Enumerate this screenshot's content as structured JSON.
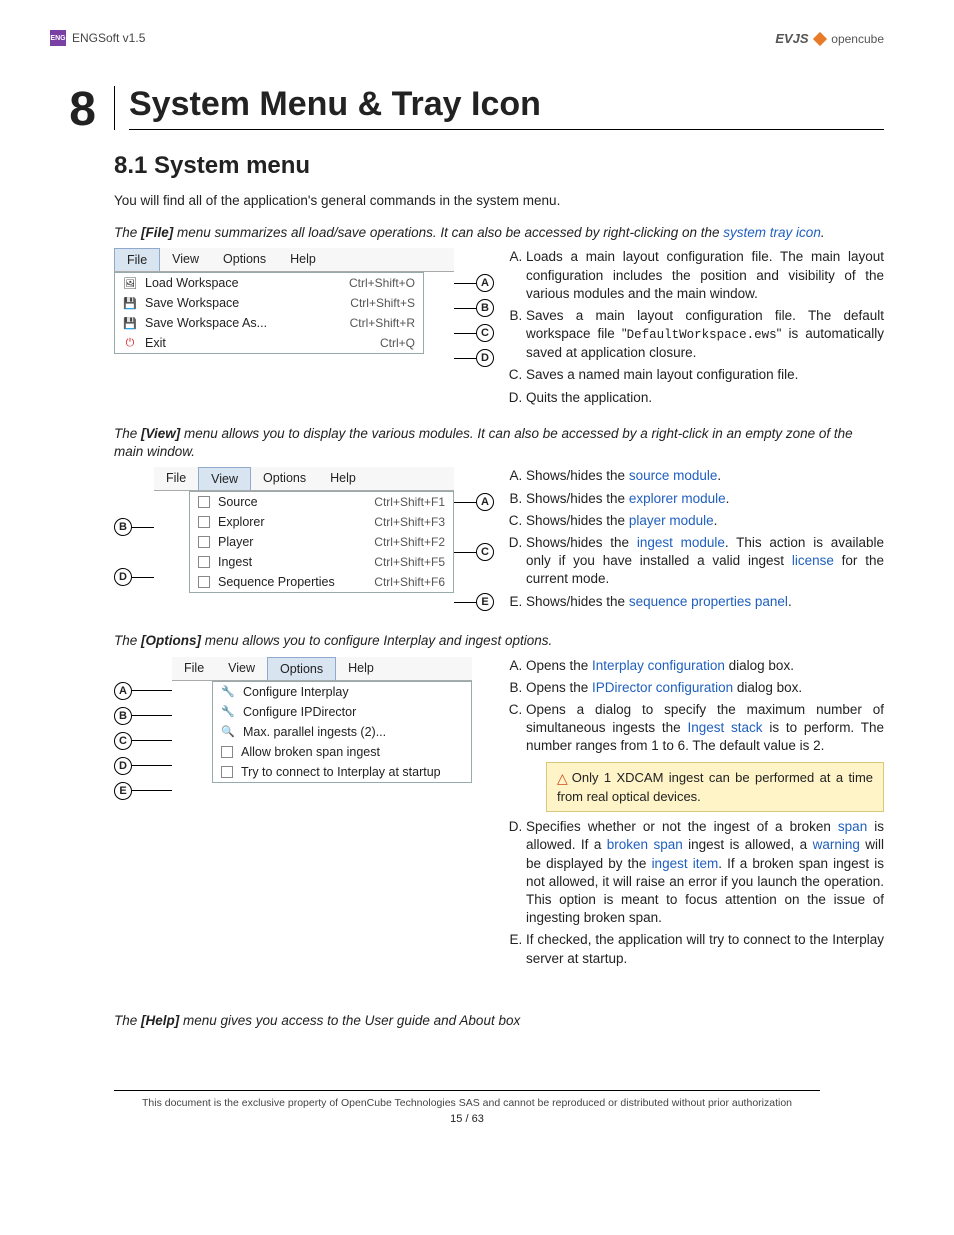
{
  "header": {
    "app": "ENGSoft v1.5",
    "brand_left": "EVJS",
    "brand_right": "opencube"
  },
  "chapter": {
    "num": "8",
    "title": "System Menu & Tray Icon"
  },
  "section": {
    "num_title": "8.1 System menu"
  },
  "intro": "You will find all of the application's general commands in the system menu.",
  "file": {
    "note_pre": "The ",
    "note_bold": "[File]",
    "note_post": " menu summarizes all load/save operations. It can also be accessed by right-clicking on the ",
    "note_link": "system tray icon",
    "note_end": ".",
    "menubar": [
      "File",
      "View",
      "Options",
      "Help"
    ],
    "items": [
      {
        "label": "Load Workspace",
        "shortcut": "Ctrl+Shift+O",
        "badge": "A"
      },
      {
        "label": "Save Workspace",
        "shortcut": "Ctrl+Shift+S",
        "badge": "B"
      },
      {
        "label": "Save Workspace As...",
        "shortcut": "Ctrl+Shift+R",
        "badge": "C"
      },
      {
        "label": "Exit",
        "shortcut": "Ctrl+Q",
        "badge": "D"
      }
    ],
    "desc": {
      "A": {
        "pre": "Loads a main layout configuration file. The main layout configuration includes the position and visibility of the various modules and the main window."
      },
      "B": {
        "pre": "Saves a main layout configuration file. The default workspace file \"",
        "code": "DefaultWorkspace.ews",
        "post": "\" is automatically saved at application closure."
      },
      "C": {
        "pre": "Saves a named main layout configuration file."
      },
      "D": {
        "pre": "Quits the application."
      }
    }
  },
  "view": {
    "note_pre": "The ",
    "note_bold": "[View]",
    "note_post": " menu allows you to display the various modules. It can also be accessed by a right-click in an empty zone of the main window.",
    "menubar": [
      "File",
      "View",
      "Options",
      "Help"
    ],
    "items": [
      {
        "label": "Source",
        "shortcut": "Ctrl+Shift+F1",
        "rbadge": "A"
      },
      {
        "label": "Explorer",
        "shortcut": "Ctrl+Shift+F3",
        "lbadge": "B"
      },
      {
        "label": "Player",
        "shortcut": "Ctrl+Shift+F2",
        "rbadge": "C"
      },
      {
        "label": "Ingest",
        "shortcut": "Ctrl+Shift+F5",
        "lbadge": "D"
      },
      {
        "label": "Sequence Properties",
        "shortcut": "Ctrl+Shift+F6",
        "rbadge": "E"
      }
    ],
    "desc": {
      "A": {
        "pre": "Shows/hides the ",
        "link": "source module",
        "post": "."
      },
      "B": {
        "pre": "Shows/hides the ",
        "link": "explorer module",
        "post": "."
      },
      "C": {
        "pre": "Shows/hides the ",
        "link": "player module",
        "post": "."
      },
      "D": {
        "pre": "Shows/hides the ",
        "link": "ingest module",
        "post": ". This action is available only if you have installed a valid ingest ",
        "link2": "license",
        "post2": " for the current mode."
      },
      "E": {
        "pre": "Shows/hides the ",
        "link": "sequence properties panel",
        "post": "."
      }
    }
  },
  "options": {
    "note_pre": "The ",
    "note_bold": "[Options]",
    "note_post": " menu allows you to configure Interplay and ingest options.",
    "menubar": [
      "File",
      "View",
      "Options",
      "Help"
    ],
    "items": [
      {
        "label": "Configure Interplay",
        "badge": "A"
      },
      {
        "label": "Configure IPDirector",
        "badge": "B"
      },
      {
        "label": "Max. parallel ingests (2)...",
        "badge": "C"
      },
      {
        "label": "Allow broken span ingest",
        "badge": "D"
      },
      {
        "label": "Try to connect to Interplay at startup",
        "badge": "E"
      }
    ],
    "desc": {
      "A": {
        "pre": "Opens the ",
        "link": "Interplay configuration",
        "post": " dialog box."
      },
      "B": {
        "pre": "Opens the ",
        "link": "IPDirector configuration",
        "post": " dialog box."
      },
      "C": {
        "pre": "Opens a dialog to specify the maximum number of simultaneous ingests the ",
        "link": "Ingest stack",
        "post": " is to perform. The number ranges from 1 to 6. The default value is 2."
      },
      "warn": "Only 1 XDCAM ingest can be performed at a time from real optical devices.",
      "D": {
        "pre": "Specifies whether or not the ingest of a broken ",
        "link": "span",
        "post": " is allowed. If a ",
        "link2": "broken span",
        "post2": " ingest is allowed, a ",
        "link3": "warning",
        "post3": " will be displayed by the ",
        "link4": "ingest item",
        "post4": ". If a broken span ingest is not allowed, it will raise an error if you launch the operation. This option is meant to focus attention on the issue of ingesting broken span."
      },
      "E": {
        "pre": "If checked, the application will try to connect to the Interplay server at startup."
      }
    }
  },
  "help_note": {
    "pre": "The ",
    "bold": "[Help]",
    "post": " menu gives you access to the User guide and About box"
  },
  "footer": {
    "disclaimer": "This document is the exclusive property of OpenCube Technologies SAS and cannot be reproduced or distributed without prior authorization",
    "page": "15 / 63"
  }
}
